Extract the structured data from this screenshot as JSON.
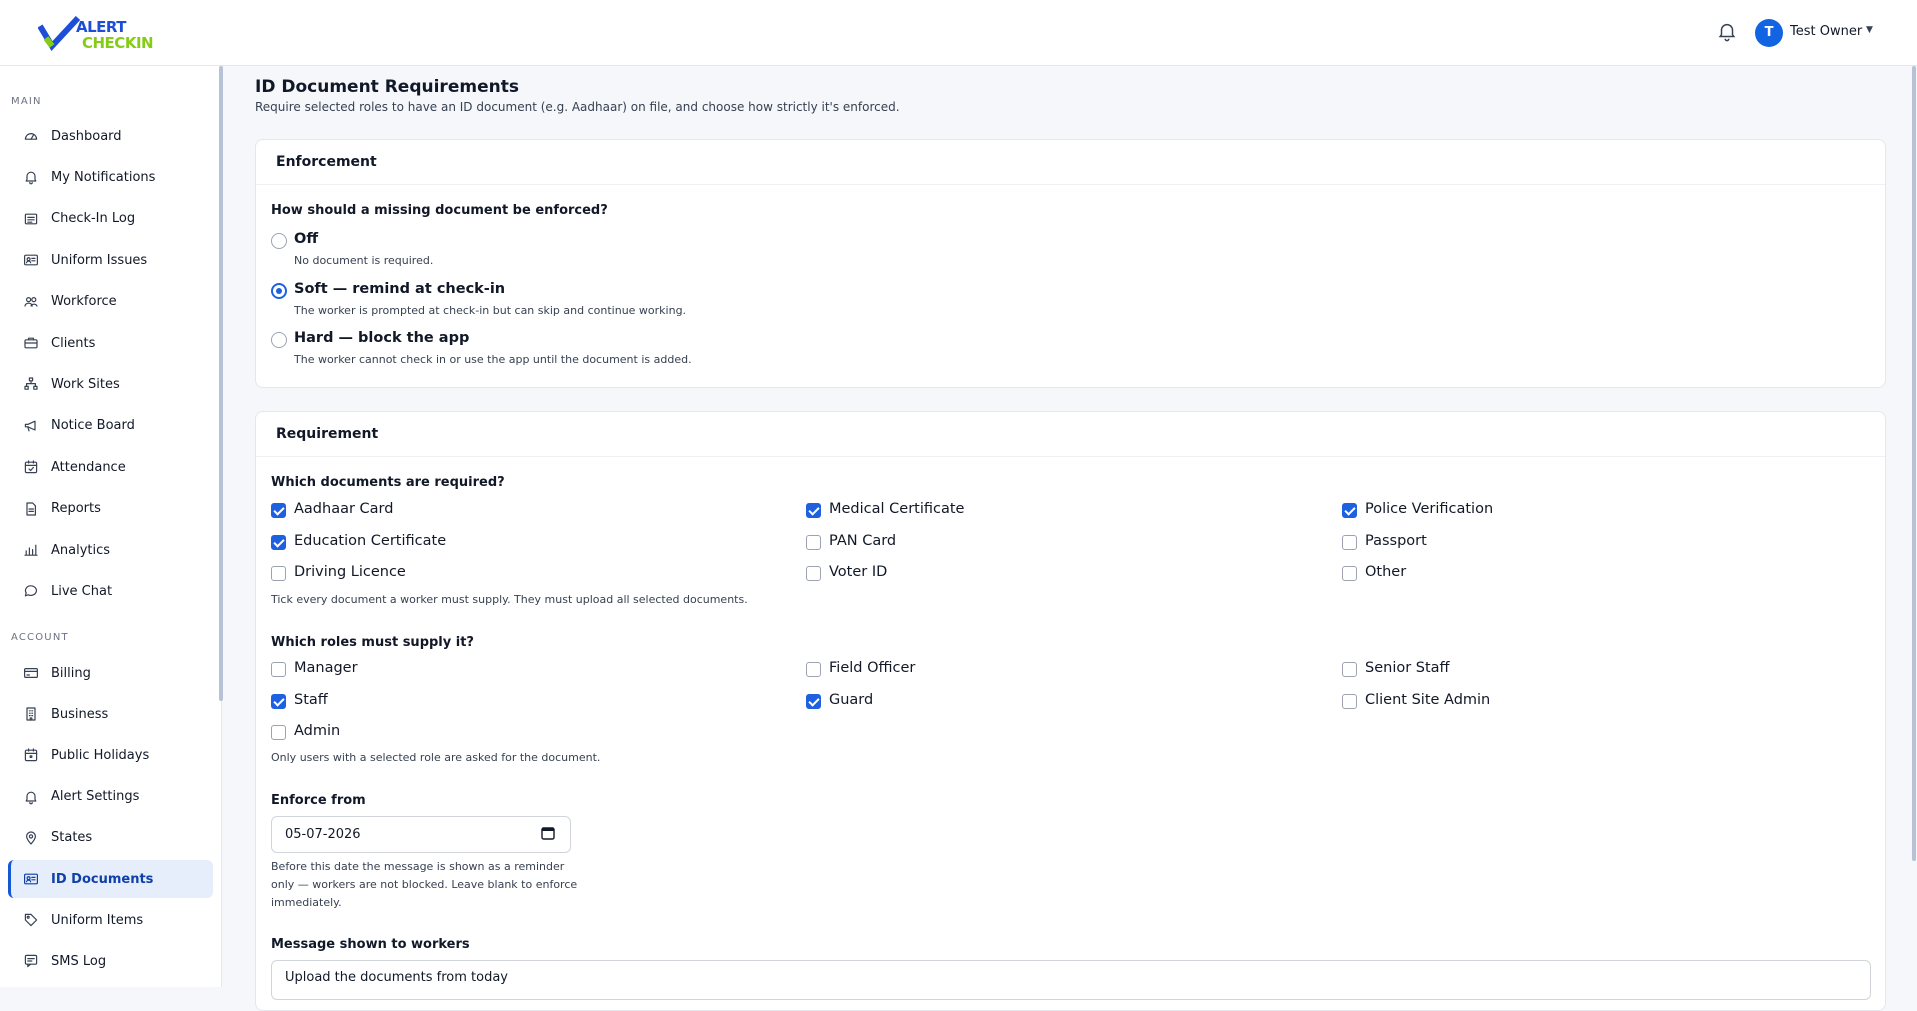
{
  "brand": {
    "line1": "ALERT",
    "line2": "CHECKIN"
  },
  "user": {
    "initial": "T",
    "name": "Test Owner"
  },
  "sidebar": {
    "main_label": "MAIN",
    "account_label": "ACCOUNT",
    "main_items": [
      {
        "label": "Dashboard",
        "icon": "dashboard-icon"
      },
      {
        "label": "My Notifications",
        "icon": "bell-icon"
      },
      {
        "label": "Check-In Log",
        "icon": "list-icon"
      },
      {
        "label": "Uniform Issues",
        "icon": "id-card-icon"
      },
      {
        "label": "Workforce",
        "icon": "users-icon"
      },
      {
        "label": "Clients",
        "icon": "briefcase-icon"
      },
      {
        "label": "Work Sites",
        "icon": "sitemap-icon"
      },
      {
        "label": "Notice Board",
        "icon": "megaphone-icon"
      },
      {
        "label": "Attendance",
        "icon": "calendar-check-icon"
      },
      {
        "label": "Reports",
        "icon": "document-icon"
      },
      {
        "label": "Analytics",
        "icon": "bar-chart-icon"
      },
      {
        "label": "Live Chat",
        "icon": "chat-icon"
      }
    ],
    "account_items": [
      {
        "label": "Billing",
        "icon": "credit-card-icon"
      },
      {
        "label": "Business",
        "icon": "building-icon"
      },
      {
        "label": "Public Holidays",
        "icon": "calendar-icon"
      },
      {
        "label": "Alert Settings",
        "icon": "bell-icon"
      },
      {
        "label": "States",
        "icon": "map-pin-icon"
      },
      {
        "label": "ID Documents",
        "icon": "id-card-icon",
        "active": true
      },
      {
        "label": "Uniform Items",
        "icon": "tag-icon"
      },
      {
        "label": "SMS Log",
        "icon": "message-icon"
      }
    ]
  },
  "page": {
    "title": "ID Document Requirements",
    "subtitle": "Require selected roles to have an ID document (e.g. Aadhaar) on file, and choose how strictly it's enforced."
  },
  "enforcement": {
    "heading": "Enforcement",
    "question": "How should a missing document be enforced?",
    "options": [
      {
        "label": "Off",
        "desc": "No document is required.",
        "selected": false
      },
      {
        "label": "Soft — remind at check-in",
        "desc": "The worker is prompted at check-in but can skip and continue working.",
        "selected": true
      },
      {
        "label": "Hard — block the app",
        "desc": "The worker cannot check in or use the app until the document is added.",
        "selected": false
      }
    ]
  },
  "requirement": {
    "heading": "Requirement",
    "documents_question": "Which documents are required?",
    "documents": [
      {
        "label": "Aadhaar Card",
        "checked": true
      },
      {
        "label": "Medical Certificate",
        "checked": true
      },
      {
        "label": "Police Verification",
        "checked": true
      },
      {
        "label": "Education Certificate",
        "checked": true
      },
      {
        "label": "PAN Card",
        "checked": false
      },
      {
        "label": "Passport",
        "checked": false
      },
      {
        "label": "Driving Licence",
        "checked": false
      },
      {
        "label": "Voter ID",
        "checked": false
      },
      {
        "label": "Other",
        "checked": false
      }
    ],
    "documents_hint": "Tick every document a worker must supply. They must upload all selected documents.",
    "roles_question": "Which roles must supply it?",
    "roles": [
      {
        "label": "Manager",
        "checked": false
      },
      {
        "label": "Field Officer",
        "checked": false
      },
      {
        "label": "Senior Staff",
        "checked": false
      },
      {
        "label": "Staff",
        "checked": true
      },
      {
        "label": "Guard",
        "checked": true
      },
      {
        "label": "Client Site Admin",
        "checked": false
      },
      {
        "label": "Admin",
        "checked": false
      }
    ],
    "roles_hint": "Only users with a selected role are asked for the document.",
    "enforce_from_label": "Enforce from",
    "enforce_from_value": "05-07-2026",
    "enforce_from_hint_1": "Before this date the message is shown as a reminder",
    "enforce_from_hint_2": "only — workers are not blocked. Leave blank to enforce",
    "enforce_from_hint_3": "immediately.",
    "message_label": "Message shown to workers",
    "message_value": "Upload the documents from today"
  },
  "colors": {
    "primary": "#1d61e0",
    "brand_blue": "#1d4ed8",
    "brand_green": "#84cc16",
    "active_bg": "#e6eefb"
  }
}
